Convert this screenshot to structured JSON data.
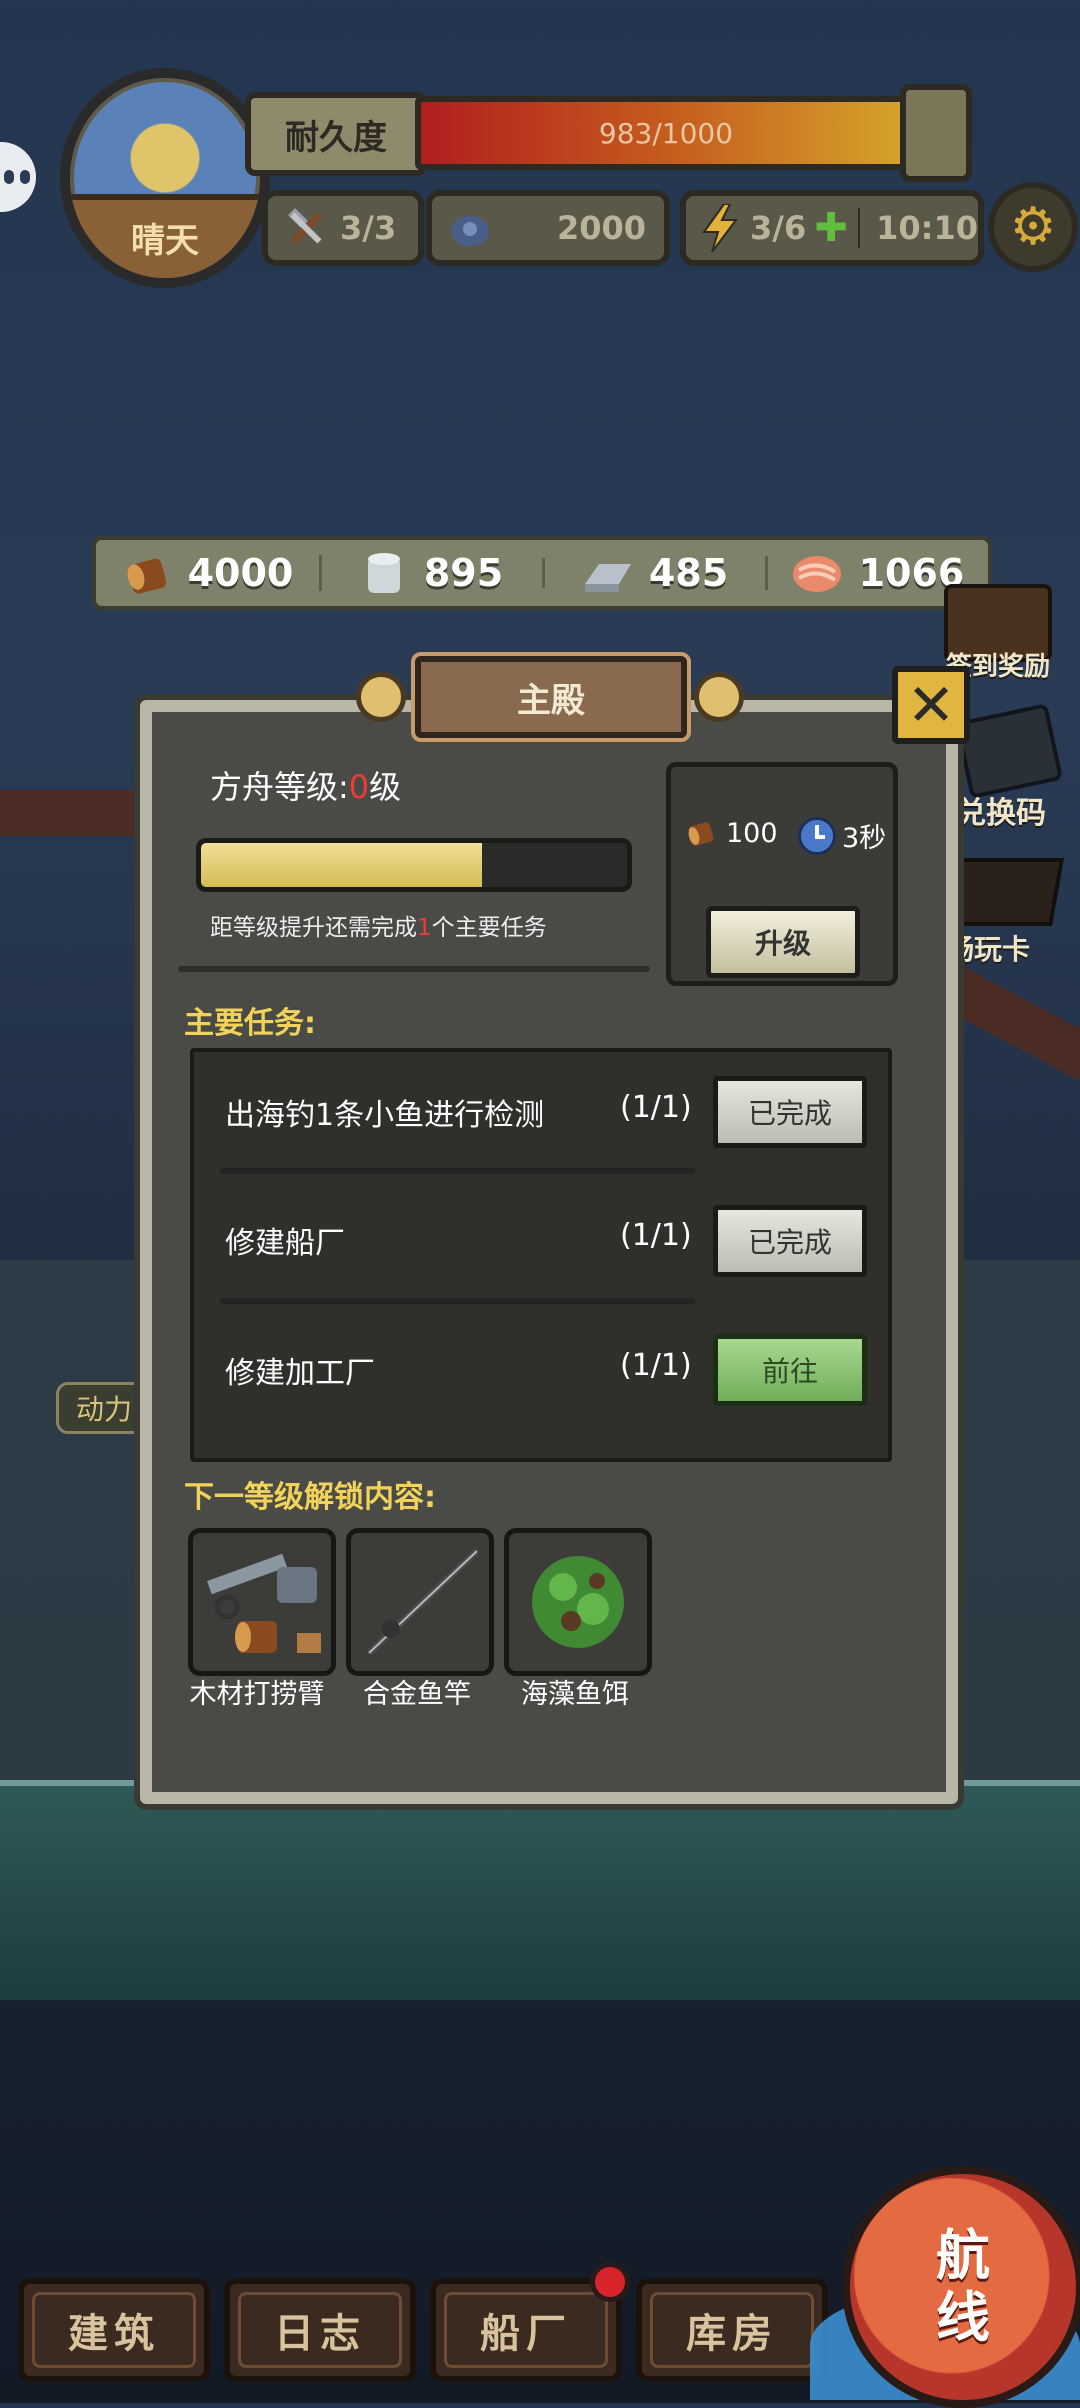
{
  "hud": {
    "weather": "晴天",
    "durability_label": "耐久度",
    "durability_value": "983/1000",
    "durability_fraction": 0.983,
    "hammer": "3/3",
    "coins": "2000",
    "energy": "3/6",
    "energy_timer": "10:10"
  },
  "resources": [
    {
      "icon": "wood-log-icon",
      "value": "4000"
    },
    {
      "icon": "wood-plank-icon",
      "value": "895"
    },
    {
      "icon": "iron-ingot-icon",
      "value": "485"
    },
    {
      "icon": "fish-meat-icon",
      "value": "1066"
    }
  ],
  "side_buttons": {
    "signin": "签到奖励",
    "redeem": "兑换码",
    "pass": "畅玩卡",
    "power": "动力"
  },
  "panel": {
    "title": "主殿",
    "level_prefix": "方舟等级:",
    "level_value": "0",
    "level_suffix": "级",
    "progress_fraction": 0.66,
    "hint_prefix": "距等级提升还需完成",
    "hint_count": "1",
    "hint_suffix": "个主要任务",
    "upgrade_cost": "100",
    "upgrade_time": "3秒",
    "upgrade_button": "升级",
    "tasks_title": "主要任务:",
    "tasks": [
      {
        "name": "出海钓1条小鱼进行检测",
        "count": "(1/1)",
        "button": "已完成",
        "state": "done"
      },
      {
        "name": "修建船厂",
        "count": "(1/1)",
        "button": "已完成",
        "state": "done"
      },
      {
        "name": "修建加工厂",
        "count": "(1/1)",
        "button": "前往",
        "state": "go"
      }
    ],
    "unlock_title": "下一等级解锁内容:",
    "unlocks": [
      {
        "label": "木材打捞臂",
        "icon": "salvage-arm-icon"
      },
      {
        "label": "合金鱼竿",
        "icon": "fishing-rod-icon"
      },
      {
        "label": "海藻鱼饵",
        "icon": "seaweed-bait-icon"
      }
    ]
  },
  "nav": {
    "build": "建筑",
    "log": "日志",
    "shipyard": "船厂",
    "storage": "库房",
    "sail_line1": "航",
    "sail_line2": "线"
  },
  "colors": {
    "accent_yellow": "#f2d35a",
    "progress": "#d6bb54",
    "alert_red": "#ef3b34",
    "go_green": "#6fae5a"
  }
}
